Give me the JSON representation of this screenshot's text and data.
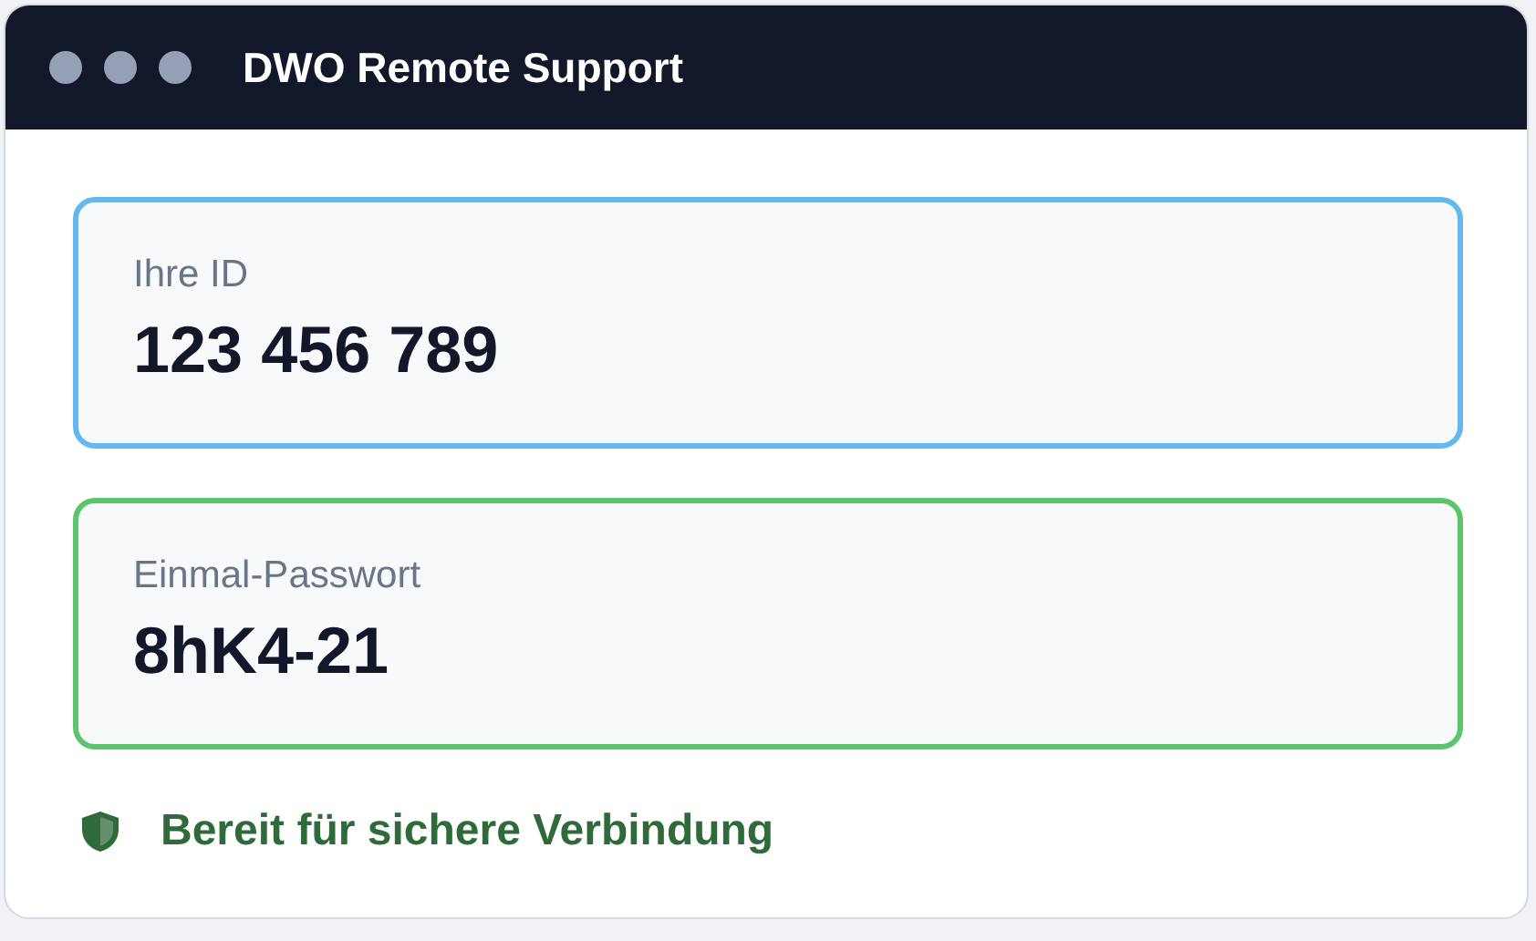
{
  "window": {
    "title": "DWO Remote Support"
  },
  "fields": [
    {
      "label": "Ihre ID",
      "value": "123 456 789",
      "color": "#63b8ee"
    },
    {
      "label": "Einmal-Passwort",
      "value": "8hK4-21",
      "color": "#5cc46a"
    }
  ],
  "status": {
    "text": "Bereit für sichere Verbindung"
  }
}
